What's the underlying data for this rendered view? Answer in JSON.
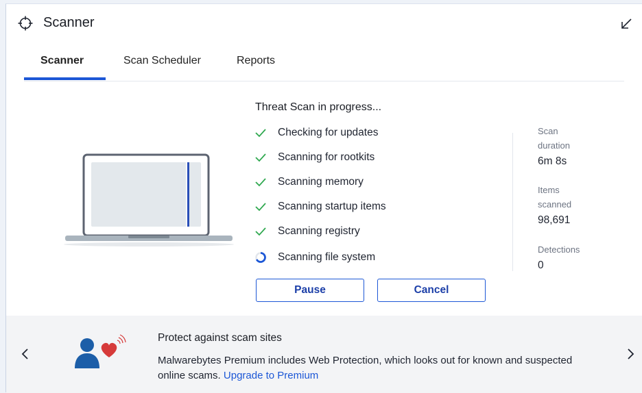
{
  "window": {
    "title": "Scanner",
    "icons": {
      "app": "crosshair-icon",
      "minimize": "minimize-arrow-icon"
    }
  },
  "tabs": [
    {
      "label": "Scanner",
      "active": true
    },
    {
      "label": "Scan Scheduler",
      "active": false
    },
    {
      "label": "Reports",
      "active": false
    }
  ],
  "scan": {
    "heading": "Threat Scan in progress...",
    "steps": [
      {
        "label": "Checking for updates",
        "status": "done"
      },
      {
        "label": "Scanning for rootkits",
        "status": "done"
      },
      {
        "label": "Scanning memory",
        "status": "done"
      },
      {
        "label": "Scanning startup items",
        "status": "done"
      },
      {
        "label": "Scanning registry",
        "status": "done"
      },
      {
        "label": "Scanning file system",
        "status": "in-progress"
      }
    ],
    "pause_label": "Pause",
    "cancel_label": "Cancel"
  },
  "stats": {
    "duration_label": "Scan duration",
    "duration_value": "6m 8s",
    "items_label": "Items scanned",
    "items_value": "98,691",
    "detections_label": "Detections",
    "detections_value": "0"
  },
  "promo": {
    "title": "Protect against scam sites",
    "body": "Malwarebytes Premium includes Web Protection, which looks out for known and suspected online scams.",
    "link": "Upgrade to Premium"
  },
  "colors": {
    "accent": "#1c57d6",
    "check": "#2fa84f",
    "heart": "#d63a3a",
    "person": "#1c5ea8"
  }
}
